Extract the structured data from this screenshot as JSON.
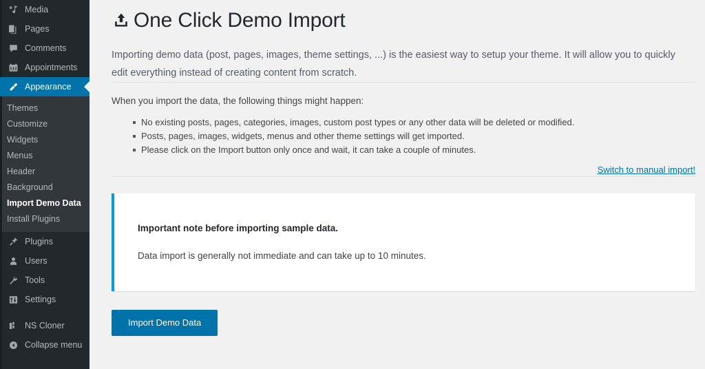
{
  "sidebar": {
    "menu_top": [
      {
        "label": "Media",
        "icon": "media-icon"
      },
      {
        "label": "Pages",
        "icon": "pages-icon"
      },
      {
        "label": "Comments",
        "icon": "comments-icon"
      },
      {
        "label": "Appointments",
        "icon": "calendar-icon"
      }
    ],
    "current": {
      "label": "Appearance",
      "icon": "paintbrush-icon"
    },
    "submenu": [
      {
        "label": "Themes",
        "active": false
      },
      {
        "label": "Customize",
        "active": false
      },
      {
        "label": "Widgets",
        "active": false
      },
      {
        "label": "Menus",
        "active": false
      },
      {
        "label": "Header",
        "active": false
      },
      {
        "label": "Background",
        "active": false
      },
      {
        "label": "Import Demo Data",
        "active": true
      },
      {
        "label": "Install Plugins",
        "active": false
      }
    ],
    "menu_bottom": [
      {
        "label": "Plugins",
        "icon": "plug-icon"
      },
      {
        "label": "Users",
        "icon": "user-icon"
      },
      {
        "label": "Tools",
        "icon": "wrench-icon"
      },
      {
        "label": "Settings",
        "icon": "sliders-icon"
      }
    ],
    "menu_extra": [
      {
        "label": "NS Cloner",
        "icon": "blocks-icon"
      }
    ],
    "collapse": {
      "label": "Collapse menu",
      "icon": "collapse-arrow-icon"
    }
  },
  "page": {
    "title": "One Click Demo Import",
    "title_icon": "upload-icon",
    "intro": "Importing demo data (post, pages, images, theme settings, ...) is the easiest way to setup your theme. It will allow you to quickly edit everything instead of creating content from scratch.",
    "lead": "When you import the data, the following things might happen:",
    "bullets": [
      "No existing posts, pages, categories, images, custom post types or any other data will be deleted or modified.",
      "Posts, pages, images, widgets, menus and other theme settings will get imported.",
      "Please click on the Import button only once and wait, it can take a couple of minutes."
    ],
    "manual_link": "Switch to manual import!",
    "notice": {
      "title": "Important note before importing sample data.",
      "body": "Data import is generally not immediate and can take up to 10 minutes."
    },
    "import_button": "Import Demo Data"
  },
  "colors": {
    "accent": "#0073aa",
    "notice_border": "#00a0d2",
    "sidebar_bg": "#23282d",
    "submenu_bg": "#32373c",
    "content_bg": "#f1f1f1"
  }
}
